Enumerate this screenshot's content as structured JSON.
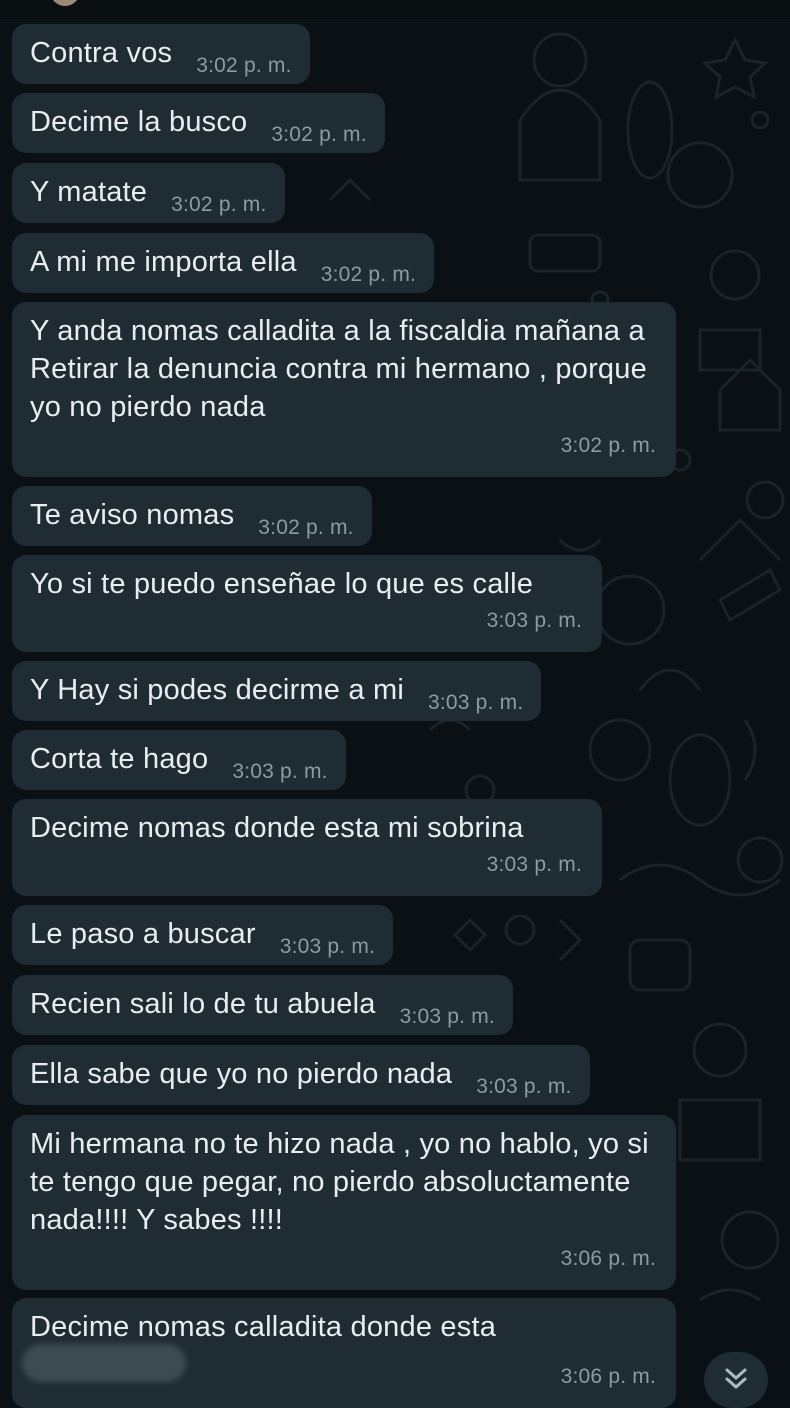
{
  "chat": {
    "messages": [
      {
        "text": "Contra vos",
        "time": "3:02 p. m."
      },
      {
        "text": "Decime la busco",
        "time": "3:02 p. m."
      },
      {
        "text": "Y matate",
        "time": "3:02 p. m."
      },
      {
        "text": "A mi me importa ella",
        "time": "3:02 p. m."
      },
      {
        "text": "Y anda nomas calladita a la fiscaldia mañana a Retirar la denuncia contra mi hermano , porque yo no pierdo nada",
        "time": "3:02 p. m."
      },
      {
        "text": "Te aviso nomas",
        "time": "3:02 p. m."
      },
      {
        "text": "Yo si te puedo enseñae lo que es calle",
        "time": "3:03 p. m."
      },
      {
        "text": "Y Hay si podes decirme a mi",
        "time": "3:03 p. m."
      },
      {
        "text": "Corta te hago",
        "time": "3:03 p. m."
      },
      {
        "text": "Decime nomas donde esta mi sobrina",
        "time": "3:03 p. m."
      },
      {
        "text": "Le paso a buscar",
        "time": "3:03 p. m."
      },
      {
        "text": "Recien sali lo de tu abuela",
        "time": "3:03 p. m."
      },
      {
        "text": "Ella sabe que yo no pierdo nada",
        "time": "3:03 p. m."
      },
      {
        "text": "Mi hermana no te hizo nada , yo no hablo, yo si te tengo que pegar, no pierdo absoluctamente nada!!!! Y sabes !!!!",
        "time": "3:06 p. m."
      },
      {
        "text": "Decime nomas calladita donde esta",
        "time": "3:06 p. m."
      }
    ]
  },
  "colors": {
    "background": "#0b1014",
    "bubble_incoming": "#1f2c33",
    "text_primary": "#e9edef",
    "text_time": "#8e9aa1"
  },
  "icons": {
    "scroll_down": "double-chevron-down-icon"
  }
}
